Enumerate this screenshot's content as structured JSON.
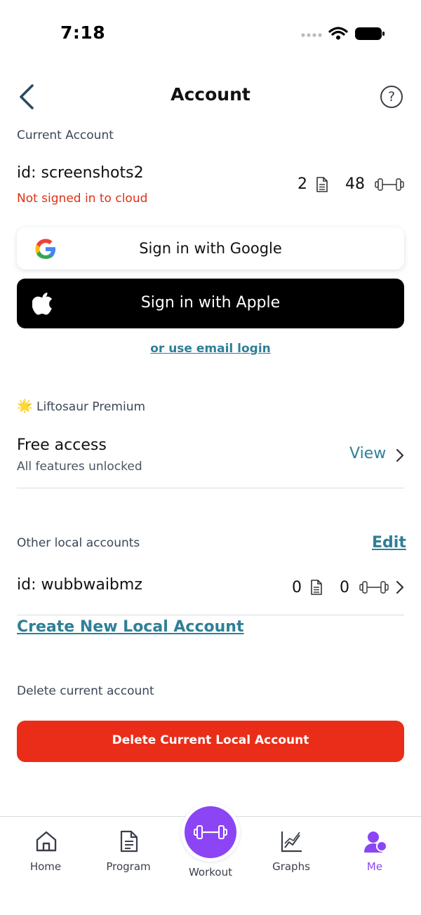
{
  "status_bar": {
    "time": "7:18"
  },
  "header": {
    "title": "Account",
    "back_icon": "chevron-left-icon",
    "help_icon": "question-circle-icon",
    "help_glyph": "?"
  },
  "current_account": {
    "section_label": "Current Account",
    "id": "id: screenshots2",
    "cloud_status": "Not signed in to cloud",
    "programs_count": "2",
    "workouts_count": "48"
  },
  "sign_in": {
    "google_label": "Sign in with Google",
    "apple_label": "Sign in with Apple",
    "email_link": "or use email login"
  },
  "premium": {
    "section_label": "Liftosaur Premium",
    "star_icon": "🌟",
    "plan_title": "Free access",
    "plan_subtitle": "All features unlocked",
    "view_label": "View"
  },
  "other_accounts": {
    "section_label": "Other local accounts",
    "edit_label": "Edit",
    "items": [
      {
        "id": "id: wubbwaibmz",
        "programs_count": "0",
        "workouts_count": "0"
      }
    ],
    "create_label": "Create New Local Account"
  },
  "delete": {
    "section_label": "Delete current account",
    "button_label": "Delete Current Local Account"
  },
  "nav": {
    "items": [
      {
        "label": "Home",
        "icon": "home-icon"
      },
      {
        "label": "Program",
        "icon": "document-icon"
      },
      {
        "label": "Workout",
        "icon": "dumbbell-icon"
      },
      {
        "label": "Graphs",
        "icon": "chart-icon"
      },
      {
        "label": "Me",
        "icon": "user-icon"
      }
    ],
    "active": "Me"
  },
  "colors": {
    "accent_purple": "#8b45f5",
    "link_teal": "#2f7f96",
    "danger_red": "#ea2d18",
    "error_text": "#e03015"
  }
}
